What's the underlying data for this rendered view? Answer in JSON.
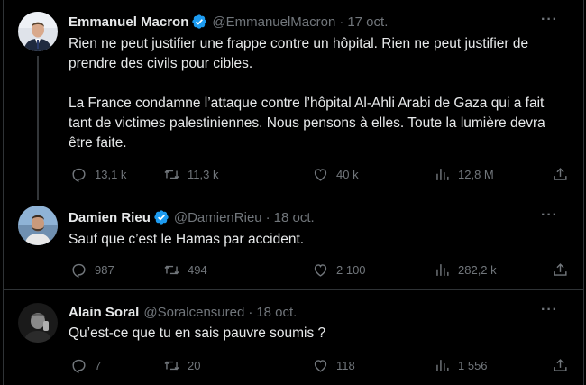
{
  "tweets": [
    {
      "name": "Emmanuel Macron",
      "verified": true,
      "handle": "@EmmanuelMacron",
      "date": "17 oct.",
      "text": "Rien ne peut justifier une frappe contre un hôpital. Rien ne peut justifier de prendre des civils pour cibles.\n\nLa France condamne l’attaque contre l’hôpital Al-Ahli Arabi de Gaza qui a fait tant de victimes palestiniennes. Nous pensons à elles. Toute la lumière devra être faite.",
      "replies": "13,1 k",
      "retweets": "11,3 k",
      "likes": "40 k",
      "views": "12,8 M"
    },
    {
      "name": "Damien Rieu",
      "verified": true,
      "handle": "@DamienRieu",
      "date": "18 oct.",
      "text": "Sauf que c’est le Hamas par accident.",
      "replies": "987",
      "retweets": "494",
      "likes": "2 100",
      "views": "282,2 k"
    },
    {
      "name": "Alain Soral",
      "verified": false,
      "handle": "@Soralcensured",
      "date": "18 oct.",
      "text": "Qu’est-ce que tu en sais pauvre soumis ?",
      "replies": "7",
      "retweets": "20",
      "likes": "118",
      "views": "1 556"
    }
  ],
  "separator": "·",
  "more_label": "···",
  "colors": {
    "background": "#000000",
    "text": "#e7e9ea",
    "secondary": "#71767b",
    "verified": "#1d9bf0",
    "border": "#2f3336"
  }
}
